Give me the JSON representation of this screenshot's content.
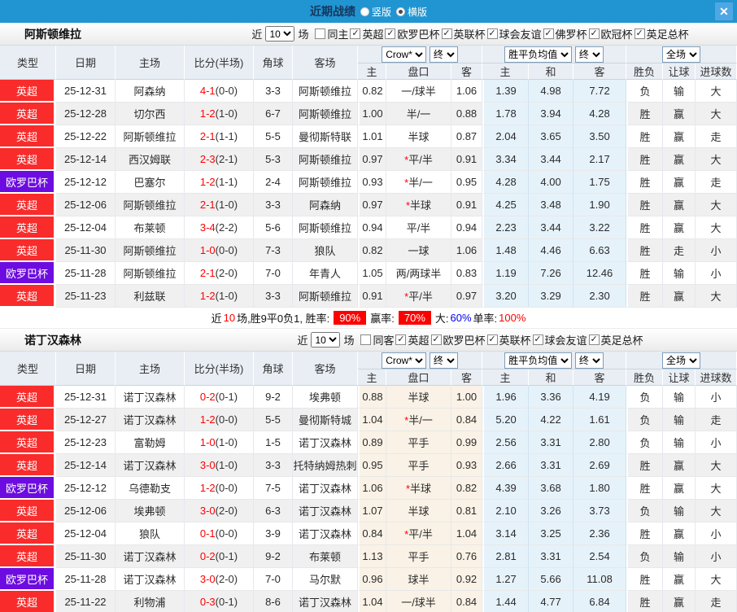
{
  "topbar": {
    "title": "近期战绩",
    "options": [
      {
        "label": "竖版",
        "checked": false
      },
      {
        "label": "横版",
        "checked": true
      }
    ],
    "close_label": "✕"
  },
  "header": {
    "near_label": "近",
    "games_label": "场",
    "count_select": "10",
    "crow_select": "Crow*",
    "end_select": "终",
    "avg_select": "胜平负均值",
    "end_select2": "终",
    "full_select": "全场",
    "cols": [
      "类型",
      "日期",
      "主场",
      "比分(半场)",
      "角球",
      "客场"
    ],
    "sub": [
      "主",
      "盘口",
      "客",
      "主",
      "和",
      "客",
      "胜负",
      "让球",
      "进球数"
    ]
  },
  "sections": [
    {
      "team": "阿斯顿维拉",
      "filter": {
        "same_label": "同主",
        "same_checked": false,
        "leagues": [
          "英超",
          "欧罗巴杯",
          "英联杯",
          "球会友谊",
          "佛罗杯",
          "欧冠杯",
          "英足总杯"
        ]
      },
      "rows": [
        {
          "lg": "英超",
          "lgc": "red",
          "date": "25-12-31",
          "home": "阿森纳",
          "hg": false,
          "score": "4-1",
          "half": "(0-0)",
          "cor": "3-3",
          "away": "阿斯顿维拉",
          "ag": true,
          "h1": "0.82",
          "hd": "一/球半",
          "h2": "1.06",
          "m1": "1.39",
          "m2": "4.98",
          "m3": "7.72",
          "r1": "负",
          "r1c": "g",
          "r2": "输",
          "r2c": "g",
          "r3": "大",
          "r3c": "r"
        },
        {
          "lg": "英超",
          "lgc": "red",
          "date": "25-12-28",
          "home": "切尔西",
          "hg": false,
          "score": "1-2",
          "half": "(1-0)",
          "cor": "6-7",
          "away": "阿斯顿维拉",
          "ag": true,
          "h1": "1.00",
          "hd": "半/一",
          "h2": "0.88",
          "m1": "1.78",
          "m2": "3.94",
          "m3": "4.28",
          "r1": "胜",
          "r1c": "r",
          "r2": "赢",
          "r2c": "r",
          "r3": "大",
          "r3c": "r"
        },
        {
          "lg": "英超",
          "lgc": "red",
          "date": "25-12-22",
          "home": "阿斯顿维拉",
          "hg": true,
          "score": "2-1",
          "half": "(1-1)",
          "cor": "5-5",
          "away": "曼彻斯特联",
          "ag": false,
          "h1": "1.01",
          "hd": "半球",
          "h2": "0.87",
          "m1": "2.04",
          "m2": "3.65",
          "m3": "3.50",
          "r1": "胜",
          "r1c": "r",
          "r2": "赢",
          "r2c": "r",
          "r3": "走",
          "r3c": "b"
        },
        {
          "lg": "英超",
          "lgc": "red",
          "date": "25-12-14",
          "home": "西汉姆联",
          "hg": false,
          "score": "2-3",
          "half": "(2-1)",
          "cor": "5-3",
          "away": "阿斯顿维拉",
          "ag": true,
          "h1": "0.97",
          "hd": "*平/半",
          "h2": "0.91",
          "m1": "3.34",
          "m2": "3.44",
          "m3": "2.17",
          "r1": "胜",
          "r1c": "r",
          "r2": "赢",
          "r2c": "r",
          "r3": "大",
          "r3c": "r"
        },
        {
          "lg": "欧罗巴杯",
          "lgc": "purple",
          "date": "25-12-12",
          "home": "巴塞尔",
          "hg": false,
          "score": "1-2",
          "half": "(1-1)",
          "cor": "2-4",
          "away": "阿斯顿维拉",
          "ag": true,
          "h1": "0.93",
          "hd": "*半/一",
          "h2": "0.95",
          "m1": "4.28",
          "m2": "4.00",
          "m3": "1.75",
          "r1": "胜",
          "r1c": "r",
          "r2": "赢",
          "r2c": "r",
          "r3": "走",
          "r3c": "b"
        },
        {
          "lg": "英超",
          "lgc": "red",
          "date": "25-12-06",
          "home": "阿斯顿维拉",
          "hg": true,
          "score": "2-1",
          "half": "(1-0)",
          "cor": "3-3",
          "away": "阿森纳",
          "ag": false,
          "h1": "0.97",
          "hd": "*半球",
          "h2": "0.91",
          "m1": "4.25",
          "m2": "3.48",
          "m3": "1.90",
          "r1": "胜",
          "r1c": "r",
          "r2": "赢",
          "r2c": "r",
          "r3": "大",
          "r3c": "r"
        },
        {
          "lg": "英超",
          "lgc": "red",
          "date": "25-12-04",
          "home": "布莱顿",
          "hg": false,
          "score": "3-4",
          "half": "(2-2)",
          "cor": "5-6",
          "away": "阿斯顿维拉",
          "ag": true,
          "h1": "0.94",
          "hd": "平/半",
          "h2": "0.94",
          "m1": "2.23",
          "m2": "3.44",
          "m3": "3.22",
          "r1": "胜",
          "r1c": "r",
          "r2": "赢",
          "r2c": "r",
          "r3": "大",
          "r3c": "r"
        },
        {
          "lg": "英超",
          "lgc": "red",
          "date": "25-11-30",
          "home": "阿斯顿维拉",
          "hg": true,
          "score": "1-0",
          "half": "(0-0)",
          "cor": "7-3",
          "away": "狼队",
          "ag": false,
          "h1": "0.82",
          "hd": "一球",
          "h2": "1.06",
          "m1": "1.48",
          "m2": "4.46",
          "m3": "6.63",
          "r1": "胜",
          "r1c": "r",
          "r2": "走",
          "r2c": "b",
          "r3": "小",
          "r3c": "g"
        },
        {
          "lg": "欧罗巴杯",
          "lgc": "purple",
          "date": "25-11-28",
          "home": "阿斯顿维拉",
          "hg": true,
          "score": "2-1",
          "half": "(2-0)",
          "cor": "7-0",
          "away": "年青人",
          "ag": false,
          "h1": "1.05",
          "hd": "两/两球半",
          "h2": "0.83",
          "m1": "1.19",
          "m2": "7.26",
          "m3": "12.46",
          "r1": "胜",
          "r1c": "r",
          "r2": "输",
          "r2c": "g",
          "r3": "小",
          "r3c": "g"
        },
        {
          "lg": "英超",
          "lgc": "red",
          "date": "25-11-23",
          "home": "利兹联",
          "hg": false,
          "score": "1-2",
          "half": "(1-0)",
          "cor": "3-3",
          "away": "阿斯顿维拉",
          "ag": true,
          "h1": "0.91",
          "hd": "*平/半",
          "h2": "0.97",
          "m1": "3.20",
          "m2": "3.29",
          "m3": "2.30",
          "r1": "胜",
          "r1c": "r",
          "r2": "赢",
          "r2c": "r",
          "r3": "大",
          "r3c": "r"
        }
      ],
      "summary": [
        {
          "t": "近",
          "c": "black"
        },
        {
          "t": "10",
          "c": "red"
        },
        {
          "t": "场,胜9平0负1, 胜率:",
          "c": "black"
        },
        {
          "t": "90%",
          "c": "badge"
        },
        {
          "t": "赢率:",
          "c": "black"
        },
        {
          "t": "70%",
          "c": "badge"
        },
        {
          "t": "大:",
          "c": "black"
        },
        {
          "t": "60%",
          "c": "blue"
        },
        {
          "t": " 单率:",
          "c": "black"
        },
        {
          "t": "100%",
          "c": "red"
        }
      ]
    },
    {
      "team": "诺丁汉森林",
      "filter": {
        "same_label": "同客",
        "same_checked": false,
        "leagues": [
          "英超",
          "欧罗巴杯",
          "英联杯",
          "球会友谊",
          "英足总杯"
        ]
      },
      "rows": [
        {
          "lg": "英超",
          "lgc": "red",
          "date": "25-12-31",
          "home": "诺丁汉森林",
          "hg": true,
          "score": "0-2",
          "half": "(0-1)",
          "cor": "9-2",
          "away": "埃弗顿",
          "ag": false,
          "h1": "0.88",
          "hd": "半球",
          "h2": "1.00",
          "m1": "1.96",
          "m2": "3.36",
          "m3": "4.19",
          "r1": "负",
          "r1c": "g",
          "r2": "输",
          "r2c": "g",
          "r3": "小",
          "r3c": "g"
        },
        {
          "lg": "英超",
          "lgc": "red",
          "date": "25-12-27",
          "home": "诺丁汉森林",
          "hg": true,
          "score": "1-2",
          "half": "(0-0)",
          "cor": "5-5",
          "away": "曼彻斯特城",
          "ag": false,
          "h1": "1.04",
          "hd": "*半/一",
          "h2": "0.84",
          "m1": "5.20",
          "m2": "4.22",
          "m3": "1.61",
          "r1": "负",
          "r1c": "g",
          "r2": "输",
          "r2c": "g",
          "r3": "走",
          "r3c": "b"
        },
        {
          "lg": "英超",
          "lgc": "red",
          "date": "25-12-23",
          "home": "富勒姆",
          "hg": false,
          "score": "1-0",
          "half": "(1-0)",
          "cor": "1-5",
          "away": "诺丁汉森林",
          "ag": true,
          "h1": "0.89",
          "hd": "平手",
          "h2": "0.99",
          "m1": "2.56",
          "m2": "3.31",
          "m3": "2.80",
          "r1": "负",
          "r1c": "g",
          "r2": "输",
          "r2c": "g",
          "r3": "小",
          "r3c": "g"
        },
        {
          "lg": "英超",
          "lgc": "red",
          "date": "25-12-14",
          "home": "诺丁汉森林",
          "hg": true,
          "score": "3-0",
          "half": "(1-0)",
          "cor": "3-3",
          "away": "托特纳姆热刺",
          "ag": false,
          "h1": "0.95",
          "hd": "平手",
          "h2": "0.93",
          "m1": "2.66",
          "m2": "3.31",
          "m3": "2.69",
          "r1": "胜",
          "r1c": "r",
          "r2": "赢",
          "r2c": "r",
          "r3": "大",
          "r3c": "r"
        },
        {
          "lg": "欧罗巴杯",
          "lgc": "purple",
          "date": "25-12-12",
          "home": "乌德勒支",
          "hg": false,
          "score": "1-2",
          "half": "(0-0)",
          "cor": "7-5",
          "away": "诺丁汉森林",
          "ag": true,
          "h1": "1.06",
          "hd": "*半球",
          "h2": "0.82",
          "m1": "4.39",
          "m2": "3.68",
          "m3": "1.80",
          "r1": "胜",
          "r1c": "r",
          "r2": "赢",
          "r2c": "r",
          "r3": "大",
          "r3c": "r"
        },
        {
          "lg": "英超",
          "lgc": "red",
          "date": "25-12-06",
          "home": "埃弗顿",
          "hg": false,
          "score": "3-0",
          "half": "(2-0)",
          "cor": "6-3",
          "away": "诺丁汉森林",
          "ag": true,
          "h1": "1.07",
          "hd": "半球",
          "h2": "0.81",
          "m1": "2.10",
          "m2": "3.26",
          "m3": "3.73",
          "r1": "负",
          "r1c": "g",
          "r2": "输",
          "r2c": "g",
          "r3": "大",
          "r3c": "r"
        },
        {
          "lg": "英超",
          "lgc": "red",
          "date": "25-12-04",
          "home": "狼队",
          "hg": false,
          "score": "0-1",
          "half": "(0-0)",
          "cor": "3-9",
          "away": "诺丁汉森林",
          "ag": true,
          "h1": "0.84",
          "hd": "*平/半",
          "h2": "1.04",
          "m1": "3.14",
          "m2": "3.25",
          "m3": "2.36",
          "r1": "胜",
          "r1c": "r",
          "r2": "赢",
          "r2c": "r",
          "r3": "小",
          "r3c": "g"
        },
        {
          "lg": "英超",
          "lgc": "red",
          "date": "25-11-30",
          "home": "诺丁汉森林",
          "hg": true,
          "score": "0-2",
          "half": "(0-1)",
          "cor": "9-2",
          "away": "布莱顿",
          "ag": false,
          "h1": "1.13",
          "hd": "平手",
          "h2": "0.76",
          "m1": "2.81",
          "m2": "3.31",
          "m3": "2.54",
          "r1": "负",
          "r1c": "g",
          "r2": "输",
          "r2c": "g",
          "r3": "小",
          "r3c": "g"
        },
        {
          "lg": "欧罗巴杯",
          "lgc": "purple",
          "date": "25-11-28",
          "home": "诺丁汉森林",
          "hg": true,
          "score": "3-0",
          "half": "(2-0)",
          "cor": "7-0",
          "away": "马尔默",
          "ag": false,
          "h1": "0.96",
          "hd": "球半",
          "h2": "0.92",
          "m1": "1.27",
          "m2": "5.66",
          "m3": "11.08",
          "r1": "胜",
          "r1c": "r",
          "r2": "赢",
          "r2c": "r",
          "r3": "大",
          "r3c": "r"
        },
        {
          "lg": "英超",
          "lgc": "red",
          "date": "25-11-22",
          "home": "利物浦",
          "hg": false,
          "score": "0-3",
          "half": "(0-1)",
          "cor": "8-6",
          "away": "诺丁汉森林",
          "ag": true,
          "h1": "1.04",
          "hd": "一/球半",
          "h2": "0.84",
          "m1": "1.44",
          "m2": "4.77",
          "m3": "6.84",
          "r1": "胜",
          "r1c": "r",
          "r2": "赢",
          "r2c": "r",
          "r3": "走",
          "r3c": "b"
        }
      ]
    }
  ]
}
